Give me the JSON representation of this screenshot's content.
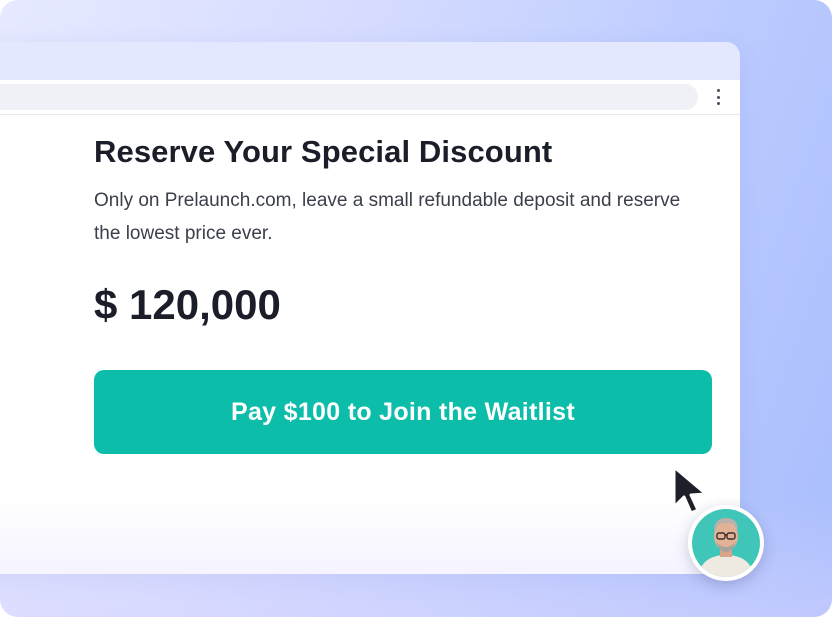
{
  "card": {
    "title": "Reserve Your Special Discount",
    "description": "Only on Prelaunch.com, leave a small refundable deposit and reserve the lowest price ever.",
    "price": "$ 120,000",
    "cta_label": "Pay $100 to Join the Waitlist"
  },
  "icons": {
    "menu": "kebab-menu-icon",
    "cursor": "mouse-pointer-icon",
    "avatar": "user-avatar"
  },
  "colors": {
    "accent": "#0cbdaa",
    "text": "#1b1e29",
    "background_gradient_start": "#e6e9ff",
    "background_gradient_end": "#a9bdfd"
  }
}
